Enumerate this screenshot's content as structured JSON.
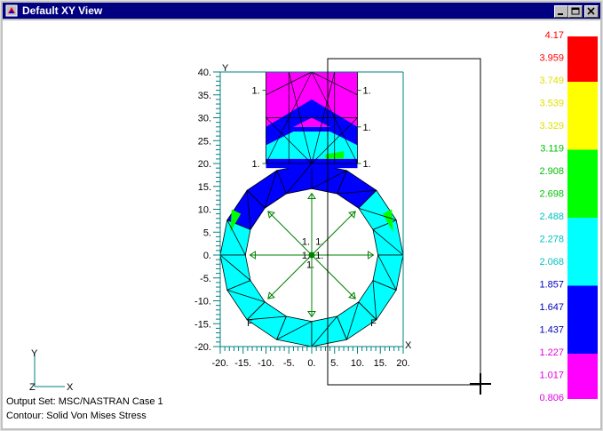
{
  "window": {
    "title": "Default XY View"
  },
  "legend": {
    "values": [
      "4.17",
      "3.959",
      "3.749",
      "3.539",
      "3.329",
      "3.119",
      "2.908",
      "2.698",
      "2.488",
      "2.278",
      "2.068",
      "1.857",
      "1.647",
      "1.437",
      "1.227",
      "1.017",
      "0.806"
    ],
    "colors": [
      "#ff0000",
      "#ff0000",
      "#ffff00",
      "#ffff00",
      "#ffff00",
      "#00ff00",
      "#00ff00",
      "#00ff00",
      "#00ffff",
      "#00ffff",
      "#00ffff",
      "#0000ff",
      "#0000ff",
      "#0000ff",
      "#ff00ff",
      "#ff00ff",
      "#ff00ff"
    ],
    "label_colors": [
      "#ff0000",
      "#ff0000",
      "#e0e000",
      "#e0e000",
      "#e0e000",
      "#00c000",
      "#00c000",
      "#00c000",
      "#00c0c0",
      "#00c0c0",
      "#00c0c0",
      "#0000c0",
      "#0000c0",
      "#0000c0",
      "#e000e0",
      "#e000e0",
      "#e000e0"
    ]
  },
  "axes": {
    "y_label": "Y",
    "x_label": "X",
    "y_ticks": [
      "40.",
      "35.",
      "30.",
      "25.",
      "20.",
      "15.",
      "10.",
      "5.",
      "0.",
      "-5.",
      "-10.",
      "-15.",
      "-20."
    ],
    "x_ticks": [
      "-20.",
      "-15.",
      "-10.",
      "-5.",
      "0.",
      "5.",
      "10.",
      "15.",
      "20."
    ]
  },
  "markers": {
    "one": "1.",
    "force": "F"
  },
  "triad": {
    "y": "Y",
    "z": "Z",
    "x": "X"
  },
  "status": {
    "output_set": "Output Set: MSC/NASTRAN Case 1",
    "contour": "Contour: Solid Von Mises Stress"
  }
}
